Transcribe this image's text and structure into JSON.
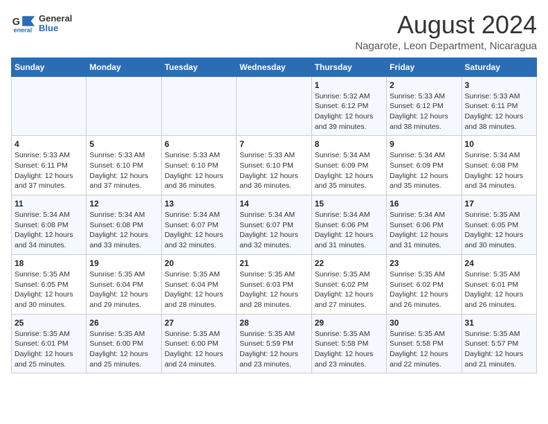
{
  "header": {
    "logo": {
      "general": "General",
      "blue": "Blue"
    },
    "title": "August 2024",
    "subtitle": "Nagarote, Leon Department, Nicaragua"
  },
  "calendar": {
    "weekdays": [
      "Sunday",
      "Monday",
      "Tuesday",
      "Wednesday",
      "Thursday",
      "Friday",
      "Saturday"
    ],
    "weeks": [
      [
        {
          "day": "",
          "info": ""
        },
        {
          "day": "",
          "info": ""
        },
        {
          "day": "",
          "info": ""
        },
        {
          "day": "",
          "info": ""
        },
        {
          "day": "1",
          "info": "Sunrise: 5:32 AM\nSunset: 6:12 PM\nDaylight: 12 hours and 39 minutes."
        },
        {
          "day": "2",
          "info": "Sunrise: 5:33 AM\nSunset: 6:12 PM\nDaylight: 12 hours and 38 minutes."
        },
        {
          "day": "3",
          "info": "Sunrise: 5:33 AM\nSunset: 6:11 PM\nDaylight: 12 hours and 38 minutes."
        }
      ],
      [
        {
          "day": "4",
          "info": "Sunrise: 5:33 AM\nSunset: 6:11 PM\nDaylight: 12 hours and 37 minutes."
        },
        {
          "day": "5",
          "info": "Sunrise: 5:33 AM\nSunset: 6:10 PM\nDaylight: 12 hours and 37 minutes."
        },
        {
          "day": "6",
          "info": "Sunrise: 5:33 AM\nSunset: 6:10 PM\nDaylight: 12 hours and 36 minutes."
        },
        {
          "day": "7",
          "info": "Sunrise: 5:33 AM\nSunset: 6:10 PM\nDaylight: 12 hours and 36 minutes."
        },
        {
          "day": "8",
          "info": "Sunrise: 5:34 AM\nSunset: 6:09 PM\nDaylight: 12 hours and 35 minutes."
        },
        {
          "day": "9",
          "info": "Sunrise: 5:34 AM\nSunset: 6:09 PM\nDaylight: 12 hours and 35 minutes."
        },
        {
          "day": "10",
          "info": "Sunrise: 5:34 AM\nSunset: 6:08 PM\nDaylight: 12 hours and 34 minutes."
        }
      ],
      [
        {
          "day": "11",
          "info": "Sunrise: 5:34 AM\nSunset: 6:08 PM\nDaylight: 12 hours and 34 minutes."
        },
        {
          "day": "12",
          "info": "Sunrise: 5:34 AM\nSunset: 6:08 PM\nDaylight: 12 hours and 33 minutes."
        },
        {
          "day": "13",
          "info": "Sunrise: 5:34 AM\nSunset: 6:07 PM\nDaylight: 12 hours and 32 minutes."
        },
        {
          "day": "14",
          "info": "Sunrise: 5:34 AM\nSunset: 6:07 PM\nDaylight: 12 hours and 32 minutes."
        },
        {
          "day": "15",
          "info": "Sunrise: 5:34 AM\nSunset: 6:06 PM\nDaylight: 12 hours and 31 minutes."
        },
        {
          "day": "16",
          "info": "Sunrise: 5:34 AM\nSunset: 6:06 PM\nDaylight: 12 hours and 31 minutes."
        },
        {
          "day": "17",
          "info": "Sunrise: 5:35 AM\nSunset: 6:05 PM\nDaylight: 12 hours and 30 minutes."
        }
      ],
      [
        {
          "day": "18",
          "info": "Sunrise: 5:35 AM\nSunset: 6:05 PM\nDaylight: 12 hours and 30 minutes."
        },
        {
          "day": "19",
          "info": "Sunrise: 5:35 AM\nSunset: 6:04 PM\nDaylight: 12 hours and 29 minutes."
        },
        {
          "day": "20",
          "info": "Sunrise: 5:35 AM\nSunset: 6:04 PM\nDaylight: 12 hours and 28 minutes."
        },
        {
          "day": "21",
          "info": "Sunrise: 5:35 AM\nSunset: 6:03 PM\nDaylight: 12 hours and 28 minutes."
        },
        {
          "day": "22",
          "info": "Sunrise: 5:35 AM\nSunset: 6:02 PM\nDaylight: 12 hours and 27 minutes."
        },
        {
          "day": "23",
          "info": "Sunrise: 5:35 AM\nSunset: 6:02 PM\nDaylight: 12 hours and 26 minutes."
        },
        {
          "day": "24",
          "info": "Sunrise: 5:35 AM\nSunset: 6:01 PM\nDaylight: 12 hours and 26 minutes."
        }
      ],
      [
        {
          "day": "25",
          "info": "Sunrise: 5:35 AM\nSunset: 6:01 PM\nDaylight: 12 hours and 25 minutes."
        },
        {
          "day": "26",
          "info": "Sunrise: 5:35 AM\nSunset: 6:00 PM\nDaylight: 12 hours and 25 minutes."
        },
        {
          "day": "27",
          "info": "Sunrise: 5:35 AM\nSunset: 6:00 PM\nDaylight: 12 hours and 24 minutes."
        },
        {
          "day": "28",
          "info": "Sunrise: 5:35 AM\nSunset: 5:59 PM\nDaylight: 12 hours and 23 minutes."
        },
        {
          "day": "29",
          "info": "Sunrise: 5:35 AM\nSunset: 5:58 PM\nDaylight: 12 hours and 23 minutes."
        },
        {
          "day": "30",
          "info": "Sunrise: 5:35 AM\nSunset: 5:58 PM\nDaylight: 12 hours and 22 minutes."
        },
        {
          "day": "31",
          "info": "Sunrise: 5:35 AM\nSunset: 5:57 PM\nDaylight: 12 hours and 21 minutes."
        }
      ]
    ]
  }
}
